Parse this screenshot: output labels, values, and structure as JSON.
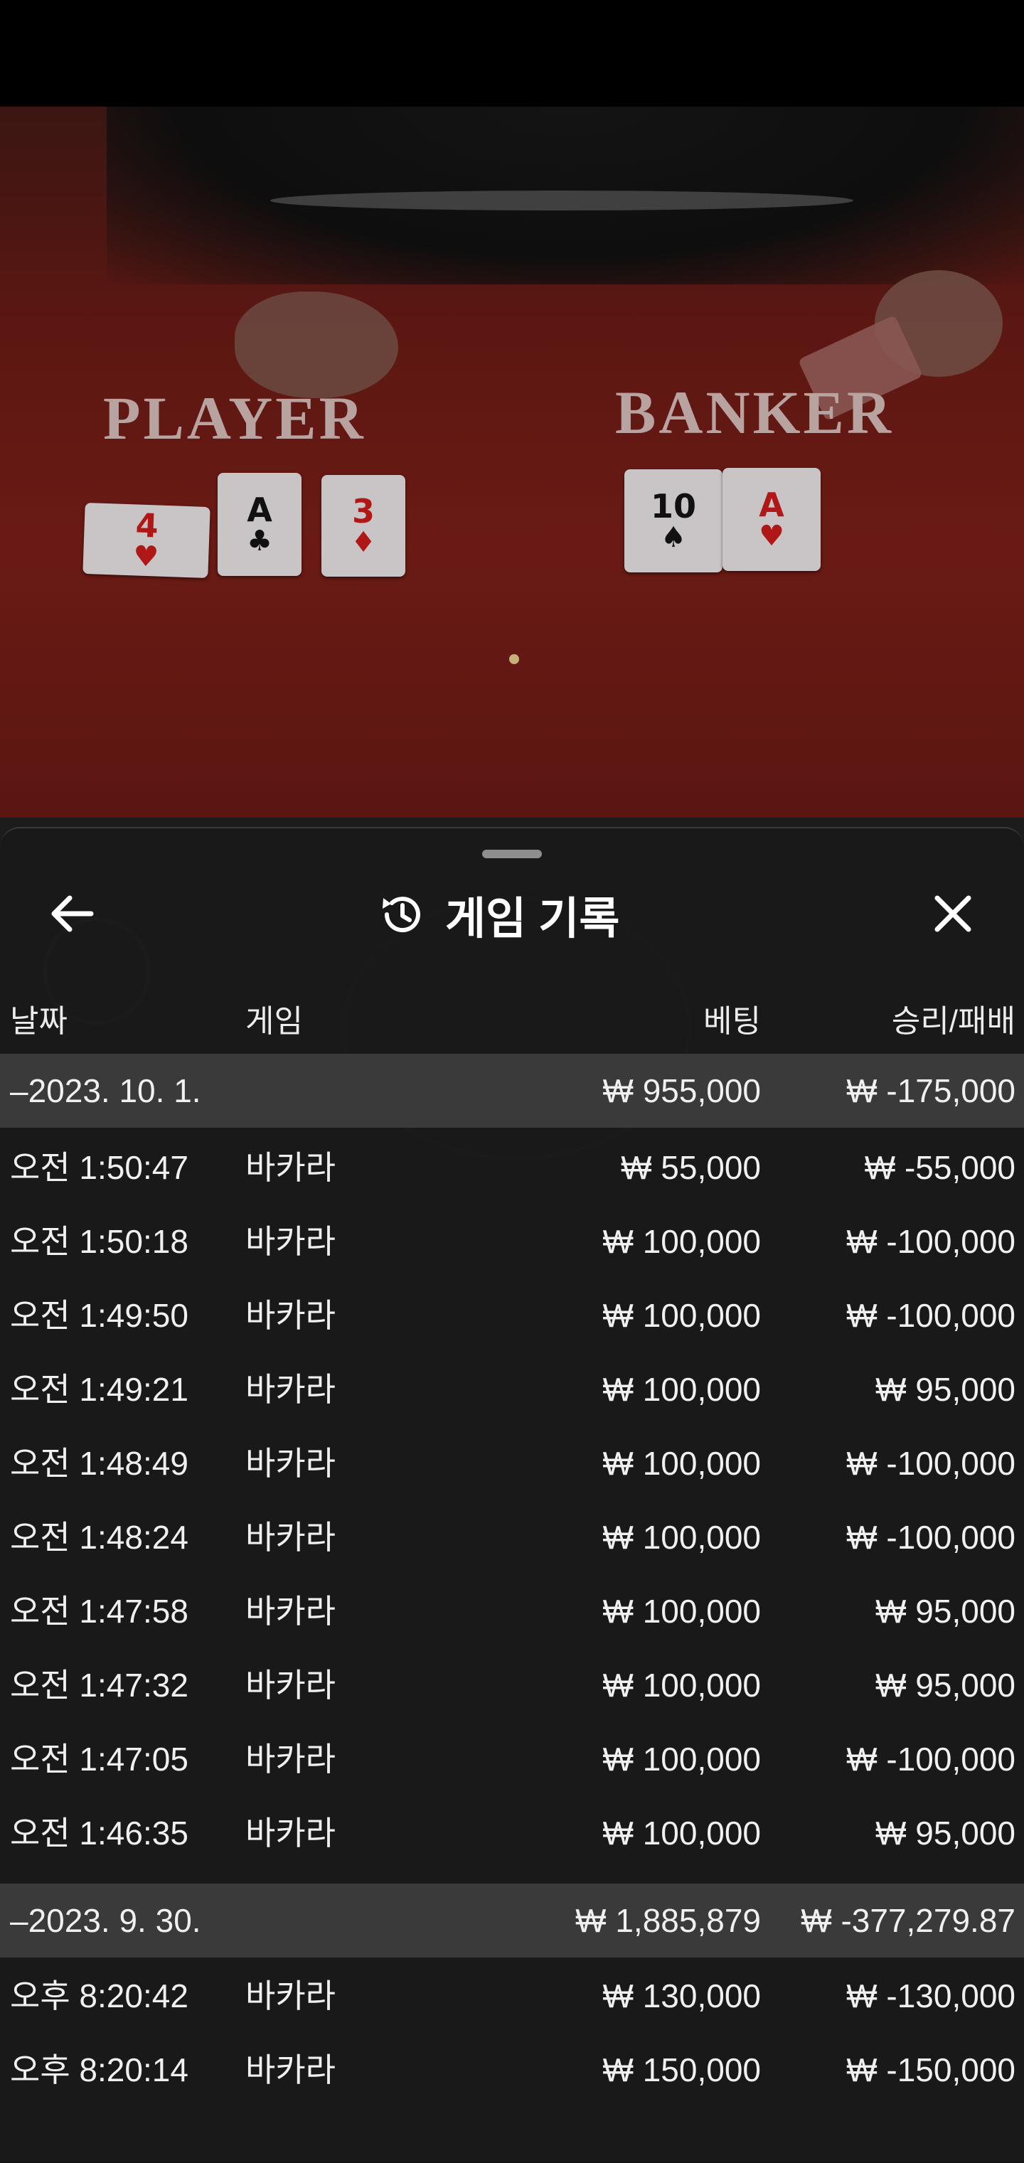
{
  "video": {
    "player_label": "PLAYER",
    "banker_label": "BANKER",
    "player_cards": [
      {
        "rank": "4",
        "suit": "♥",
        "color": "red"
      },
      {
        "rank": "A",
        "suit": "♣",
        "color": "black"
      },
      {
        "rank": "3",
        "suit": "♦",
        "color": "red"
      }
    ],
    "banker_cards": [
      {
        "rank": "10",
        "suit": "♠",
        "color": "black"
      },
      {
        "rank": "A",
        "suit": "♥",
        "color": "red"
      }
    ]
  },
  "sheet": {
    "title": "게임 기록",
    "title_icon": "history-icon",
    "back_icon": "arrow-left-icon",
    "close_icon": "close-icon",
    "columns": {
      "date": "날짜",
      "game": "게임",
      "bet": "베팅",
      "result": "승리/패배"
    },
    "rows": [
      {
        "type": "group",
        "time": "–2023. 10. 1.",
        "game": "",
        "bet": "₩ 955,000",
        "result": "₩ -175,000"
      },
      {
        "type": "item",
        "time": "오전 1:50:47",
        "game": "바카라",
        "bet": "₩ 55,000",
        "result": "₩ -55,000"
      },
      {
        "type": "item",
        "time": "오전 1:50:18",
        "game": "바카라",
        "bet": "₩ 100,000",
        "result": "₩ -100,000"
      },
      {
        "type": "item",
        "time": "오전 1:49:50",
        "game": "바카라",
        "bet": "₩ 100,000",
        "result": "₩ -100,000"
      },
      {
        "type": "item",
        "time": "오전 1:49:21",
        "game": "바카라",
        "bet": "₩ 100,000",
        "result": "₩ 95,000"
      },
      {
        "type": "item",
        "time": "오전 1:48:49",
        "game": "바카라",
        "bet": "₩ 100,000",
        "result": "₩ -100,000"
      },
      {
        "type": "item",
        "time": "오전 1:48:24",
        "game": "바카라",
        "bet": "₩ 100,000",
        "result": "₩ -100,000"
      },
      {
        "type": "item",
        "time": "오전 1:47:58",
        "game": "바카라",
        "bet": "₩ 100,000",
        "result": "₩ 95,000"
      },
      {
        "type": "item",
        "time": "오전 1:47:32",
        "game": "바카라",
        "bet": "₩ 100,000",
        "result": "₩ 95,000"
      },
      {
        "type": "item",
        "time": "오전 1:47:05",
        "game": "바카라",
        "bet": "₩ 100,000",
        "result": "₩ -100,000"
      },
      {
        "type": "item",
        "time": "오전 1:46:35",
        "game": "바카라",
        "bet": "₩ 100,000",
        "result": "₩ 95,000"
      },
      {
        "type": "group",
        "time": "–2023. 9. 30.",
        "game": "",
        "bet": "₩ 1,885,879",
        "result": "₩ -377,279.87"
      },
      {
        "type": "item",
        "time": "오후 8:20:42",
        "game": "바카라",
        "bet": "₩ 130,000",
        "result": "₩ -130,000"
      },
      {
        "type": "item",
        "time": "오후 8:20:14",
        "game": "바카라",
        "bet": "₩ 150,000",
        "result": "₩ -150,000"
      }
    ]
  },
  "colors": {
    "sheet_bg": "#181818",
    "group_row_bg": "#3a3a3a",
    "felt": "#6a1a14"
  }
}
